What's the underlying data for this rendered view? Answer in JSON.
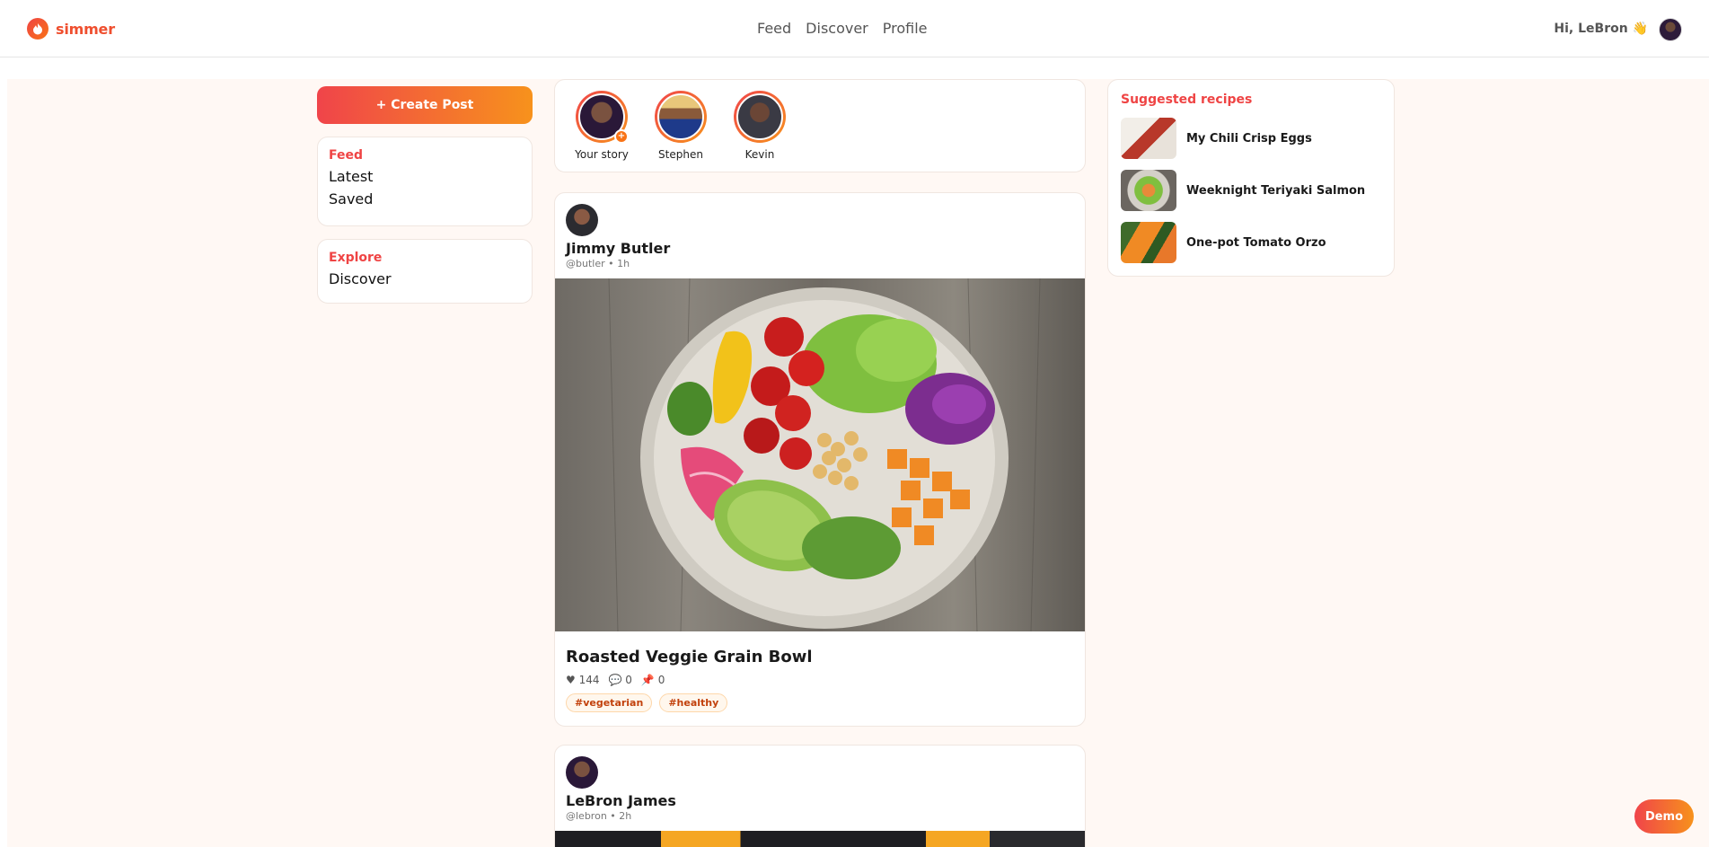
{
  "brand": {
    "name": "simmer",
    "logo_icon": "flame-icon"
  },
  "nav": {
    "items": [
      "Feed",
      "Discover",
      "Profile"
    ]
  },
  "user": {
    "greeting": "Hi, LeBron 👋"
  },
  "sidebar": {
    "create_label": "+ Create Post",
    "feed_section": "Feed",
    "feed_items": [
      "Latest",
      "Saved"
    ],
    "explore_section": "Explore",
    "explore_items": [
      "Discover"
    ]
  },
  "stories": [
    {
      "label": "Your story"
    },
    {
      "label": "Stephen"
    },
    {
      "label": "Kevin"
    }
  ],
  "posts": [
    {
      "author": "Jimmy Butler",
      "meta": "@butler • 1h",
      "title": "Roasted Veggie Grain Bowl",
      "likes": "144",
      "comments": "0",
      "saves": "0",
      "tags": [
        "#vegetarian",
        "#healthy"
      ]
    },
    {
      "author": "LeBron James",
      "meta": "@lebron • 2h"
    }
  ],
  "suggested": {
    "title": "Suggested recipes",
    "items": [
      "My Chili Crisp Eggs",
      "Weeknight Teriyaki Salmon",
      "One-pot Tomato Orzo"
    ]
  },
  "demo_label": "Demo",
  "colors": {
    "accent": "#ef4444",
    "accent2": "#f97316",
    "page_bg": "#fff8f4"
  }
}
